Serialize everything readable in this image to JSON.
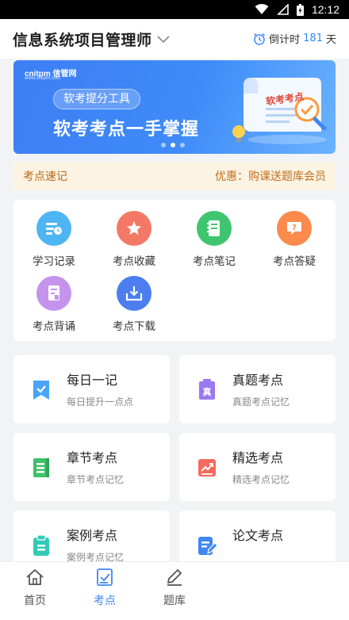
{
  "status_bar": {
    "time": "12:12"
  },
  "header": {
    "title": "信息系统项目管理师",
    "countdown_prefix": "倒计时",
    "countdown_days": "181",
    "countdown_suffix": "天"
  },
  "banner": {
    "brand": "cnitpm 信管网",
    "brand_url": "www.cnitpm.com",
    "tag": "软考提分工具",
    "headline": "软考考点一手掌握",
    "scroll_label": "软考考点",
    "page_count": 3,
    "active_page": 1
  },
  "notice": {
    "left": "考点速记",
    "right": "优惠：购课送题库会员"
  },
  "features": [
    {
      "label": "学习记录",
      "icon": "study-record-icon",
      "color": "#4db5f2"
    },
    {
      "label": "考点收藏",
      "icon": "star-icon",
      "color": "#f47866"
    },
    {
      "label": "考点笔记",
      "icon": "notebook-icon",
      "color": "#3fc56f"
    },
    {
      "label": "考点答疑",
      "icon": "question-icon",
      "color": "#fb8a4d"
    },
    {
      "label": "考点背诵",
      "icon": "recite-icon",
      "color": "#c592ec"
    },
    {
      "label": "考点下载",
      "icon": "download-icon",
      "color": "#4c7ef0"
    }
  ],
  "cards": [
    {
      "title": "每日一记",
      "subtitle": "每日提升一点点",
      "icon": "bookmark-check-icon",
      "color": "#4aa6f5"
    },
    {
      "title": "真题考点",
      "subtitle": "真题考点记忆",
      "icon": "exam-paper-icon",
      "color": "#9b79f0"
    },
    {
      "title": "章节考点",
      "subtitle": "章节考点记忆",
      "icon": "chapter-icon",
      "color": "#3fc06a"
    },
    {
      "title": "精选考点",
      "subtitle": "精选考点记忆",
      "icon": "trend-icon",
      "color": "#f56a5e"
    },
    {
      "title": "案例考点",
      "subtitle": "案例考点记忆",
      "icon": "clipboard-icon",
      "color": "#33c9b8"
    },
    {
      "title": "论文考点",
      "subtitle": "",
      "icon": "essay-icon",
      "color": "#3f87f5"
    }
  ],
  "tabs": [
    {
      "label": "首页",
      "icon": "home-icon"
    },
    {
      "label": "考点",
      "icon": "exam-point-icon",
      "active": true
    },
    {
      "label": "题库",
      "icon": "question-bank-icon"
    }
  ],
  "colors": {
    "accent": "#3f87f5",
    "notice_text": "#b56a1c",
    "notice_bg": "#fdf3e2"
  }
}
